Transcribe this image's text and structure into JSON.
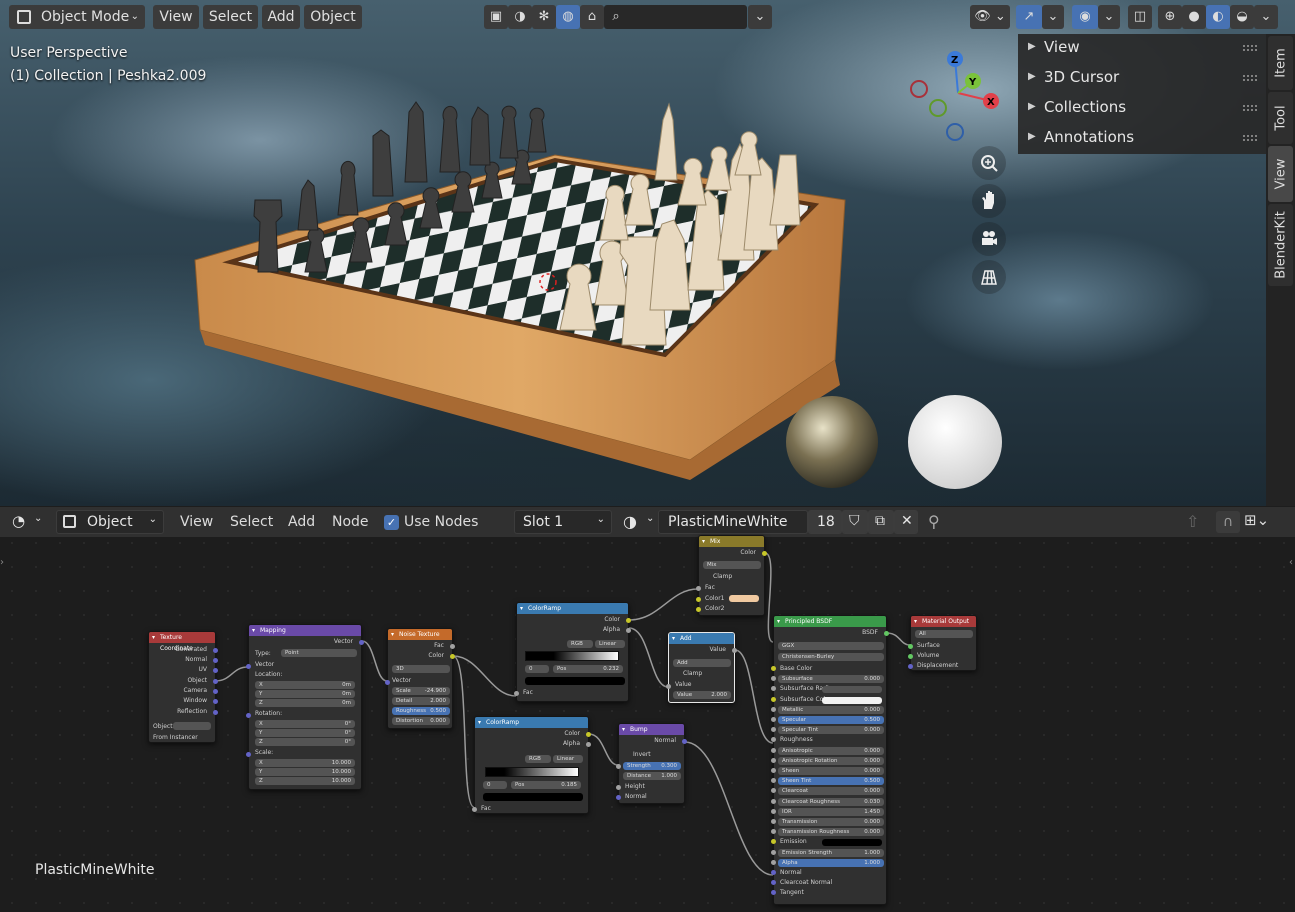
{
  "viewport": {
    "mode_label": "Object Mode",
    "menu": [
      "View",
      "Select",
      "Add",
      "Object"
    ],
    "overlay_view": "User Perspective",
    "overlay_collection": "(1) Collection | Peshka2.009",
    "gizmo_axes": {
      "z": "Z",
      "y": "Y",
      "x": "X"
    },
    "npanel_sections": [
      "View",
      "3D Cursor",
      "Collections",
      "Annotations"
    ],
    "side_tabs": [
      "Item",
      "Tool",
      "View",
      "BlenderKit"
    ]
  },
  "node_editor": {
    "editor_type_label": "Object",
    "menu": [
      "View",
      "Select",
      "Add",
      "Node"
    ],
    "use_nodes_label": "Use Nodes",
    "use_nodes_checked": true,
    "slot_label": "Slot 1",
    "material_name": "PlasticMineWhite",
    "user_count": "18",
    "footer_material": "PlasticMineWhite",
    "nodes": {
      "texcoord": {
        "title": "Texture Coordinate",
        "outputs": [
          "Generated",
          "Normal",
          "UV",
          "Object",
          "Camera",
          "Window",
          "Reflection"
        ],
        "object_label": "Object:",
        "from_instancer": "From Instancer"
      },
      "mapping": {
        "title": "Mapping",
        "out": "Vector",
        "type_label": "Type:",
        "type_value": "Point",
        "in": "Vector",
        "location": "Location:",
        "rotation": "Rotation:",
        "scale": "Scale:",
        "axes": [
          "X",
          "Y",
          "Z"
        ],
        "loc_values": [
          "0m",
          "0m",
          "0m"
        ],
        "rot_values": [
          "0°",
          "0°",
          "0°"
        ],
        "scale_values": [
          "10.000",
          "10.000",
          "10.000"
        ]
      },
      "noise": {
        "title": "Noise Texture",
        "outputs": [
          "Fac",
          "Color"
        ],
        "dim": "3D",
        "in": "Vector",
        "fields": [
          {
            "label": "Scale",
            "value": "-24.900"
          },
          {
            "label": "Detail",
            "value": "2.000"
          },
          {
            "label": "Roughness",
            "value": "0.500"
          },
          {
            "label": "Distortion",
            "value": "0.000"
          }
        ]
      },
      "ramp1": {
        "title": "ColorRamp",
        "outputs": [
          "Color",
          "Alpha"
        ],
        "mode": "RGB",
        "interp": "Linear",
        "index": "0",
        "pos_label": "Pos",
        "pos_value": "0.232",
        "in": "Fac"
      },
      "ramp2": {
        "title": "ColorRamp",
        "outputs": [
          "Color",
          "Alpha"
        ],
        "mode": "RGB",
        "interp": "Linear",
        "index": "0",
        "pos_label": "Pos",
        "pos_value": "0.185",
        "in": "Fac"
      },
      "mix": {
        "title": "Mix",
        "out": "Color",
        "blend": "Mix",
        "clamp": "Clamp",
        "inputs": [
          "Fac",
          "Color1",
          "Color2"
        ]
      },
      "add": {
        "title": "Add",
        "out": "Value",
        "op": "Add",
        "clamp": "Clamp",
        "in": "Value",
        "value_label": "Value",
        "value_value": "2.000"
      },
      "bump": {
        "title": "Bump",
        "out": "Normal",
        "invert": "Invert",
        "fields": [
          {
            "label": "Strength",
            "value": "0.300"
          },
          {
            "label": "Distance",
            "value": "1.000"
          }
        ],
        "inputs": [
          "Height",
          "Normal"
        ]
      },
      "bsdf": {
        "title": "Principled BSDF",
        "out": "BSDF",
        "dist": "GGX",
        "sss": "Christensen-Burley",
        "rows": [
          {
            "label": "Base Color",
            "type": "socket"
          },
          {
            "label": "Subsurface",
            "value": "0.000"
          },
          {
            "label": "Subsurface Radius",
            "type": "dropdown"
          },
          {
            "label": "Subsurface Col",
            "type": "color"
          },
          {
            "label": "Metallic",
            "value": "0.000"
          },
          {
            "label": "Specular",
            "value": "0.500",
            "blue": true
          },
          {
            "label": "Specular Tint",
            "value": "0.000"
          },
          {
            "label": "Roughness",
            "type": "socket"
          },
          {
            "label": "Anisotropic",
            "value": "0.000"
          },
          {
            "label": "Anisotropic Rotation",
            "value": "0.000"
          },
          {
            "label": "Sheen",
            "value": "0.000"
          },
          {
            "label": "Sheen Tint",
            "value": "0.500",
            "blue": true
          },
          {
            "label": "Clearcoat",
            "value": "0.000"
          },
          {
            "label": "Clearcoat Roughness",
            "value": "0.030"
          },
          {
            "label": "IOR",
            "value": "1.450"
          },
          {
            "label": "Transmission",
            "value": "0.000"
          },
          {
            "label": "Transmission Roughness",
            "value": "0.000"
          },
          {
            "label": "Emission",
            "type": "black"
          },
          {
            "label": "Emission Strength",
            "value": "1.000"
          },
          {
            "label": "Alpha",
            "value": "1.000",
            "blue": true
          },
          {
            "label": "Normal",
            "type": "socket"
          },
          {
            "label": "Clearcoat Normal",
            "type": "socket"
          },
          {
            "label": "Tangent",
            "type": "socket"
          }
        ]
      },
      "output": {
        "title": "Material Output",
        "target": "All",
        "inputs": [
          "Surface",
          "Volume",
          "Displacement"
        ]
      }
    }
  },
  "colors": {
    "accent_blue": "#4772b3",
    "header_bg": "#303030"
  }
}
